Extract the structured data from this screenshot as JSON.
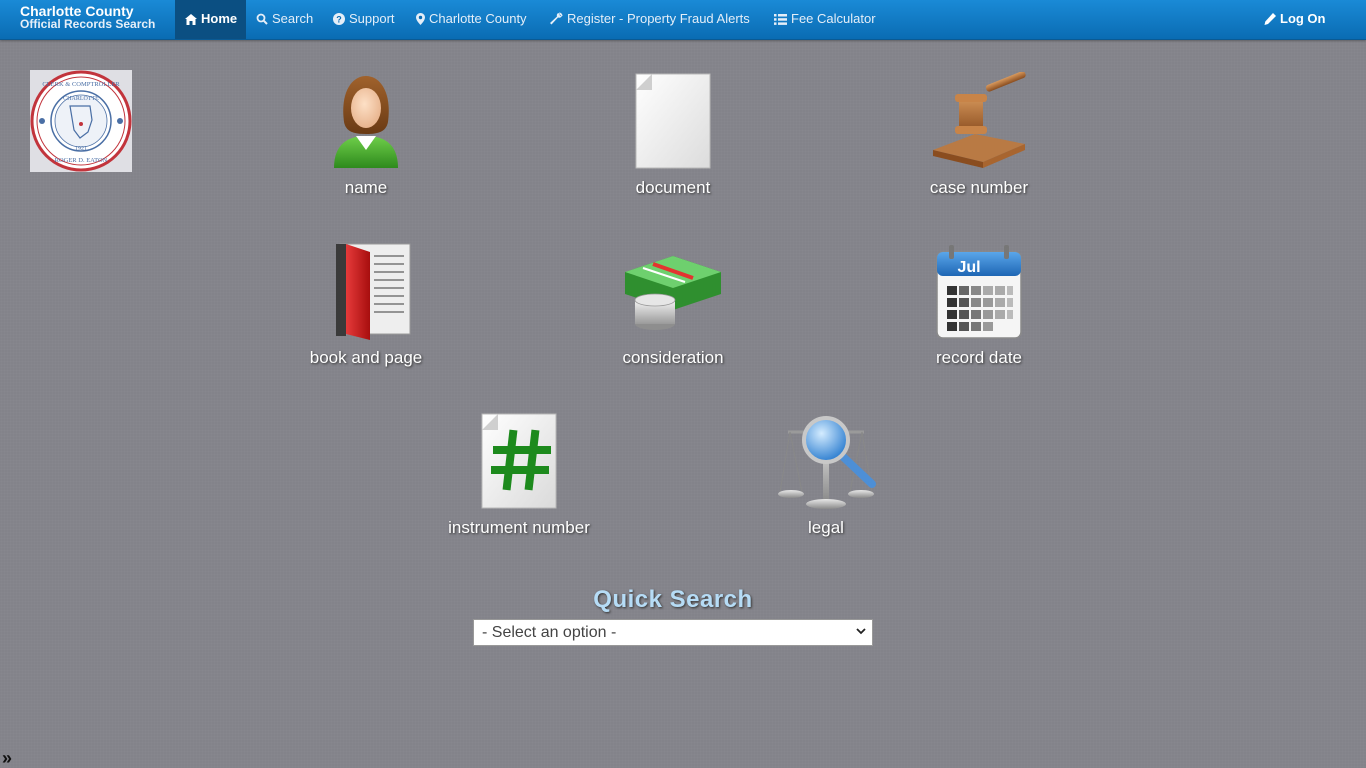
{
  "brand": {
    "line1": "Charlotte County",
    "line2": "Official Records Search"
  },
  "nav": {
    "home": "Home",
    "search": "Search",
    "support": "Support",
    "county": "Charlotte County",
    "register": "Register - Property Fraud Alerts",
    "fee": "Fee Calculator",
    "logon": "Log On"
  },
  "seal": {
    "text": "CLERK & COMPTROLLER · CHARLOTTE COUNTY · FLORIDA · ROGER D. EATON · 1921"
  },
  "tiles": {
    "name": "name",
    "document": "document",
    "case_number": "case number",
    "book_page": "book and page",
    "consideration": "consideration",
    "record_date": "record date",
    "instrument_number": "instrument number",
    "legal": "legal"
  },
  "calendar_month": "Jul",
  "quick_search": {
    "title": "Quick Search",
    "selected": "- Select an option -"
  },
  "expander": "»",
  "colors": {
    "nav": "#0a6cb3",
    "nav_active": "#0b4f82",
    "bg": "#83838a",
    "qs_title": "#b6dcf6"
  }
}
